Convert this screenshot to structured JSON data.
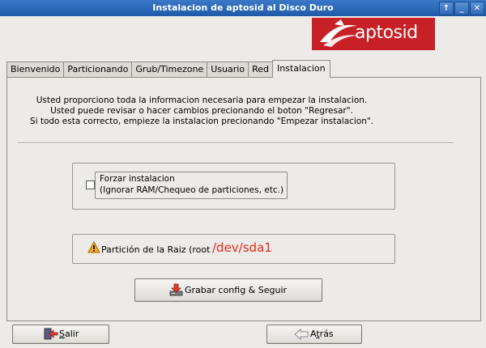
{
  "window": {
    "title": "Instalacion de aptosid al Disco Duro",
    "controls": [
      "↑",
      "_",
      "✕"
    ]
  },
  "logo": {
    "text": "aptosid"
  },
  "tabs": [
    {
      "label": "Bienvenido"
    },
    {
      "label": "Particionando"
    },
    {
      "label": "Grub/Timezone"
    },
    {
      "label": "Usuario"
    },
    {
      "label": "Red"
    },
    {
      "label": "Instalacion",
      "active": true
    }
  ],
  "info": {
    "line1": "Usted proporciono toda la informacion necesaria para empezar la instalacion.",
    "line2": "Usted puede revisar o hacer cambios precionando el boton \"Regresar\".",
    "line3": "Si todo esta correcto, empieze la instalacion precionando \"Empezar instalacion\"."
  },
  "force_install": {
    "label_line1": "Forzar instalacion",
    "label_line2": "(Ignorar RAM/Chequeo de particiones, etc.)",
    "checked": false
  },
  "root_partition": {
    "label": "Partición de la Raiz (root",
    "value": "/dev/sda1",
    "value_color": "#e8261b"
  },
  "buttons": {
    "grabar": "Grabar config & Seguir",
    "salir_mnemonic": "S",
    "salir_rest": "alir",
    "atras_pre": "A",
    "atras_mnemonic": "t",
    "atras_rest": "rás"
  },
  "colors": {
    "titlebar": "#2a6abb",
    "logo_bg": "#c72027",
    "window_bg": "#ecebe8"
  }
}
